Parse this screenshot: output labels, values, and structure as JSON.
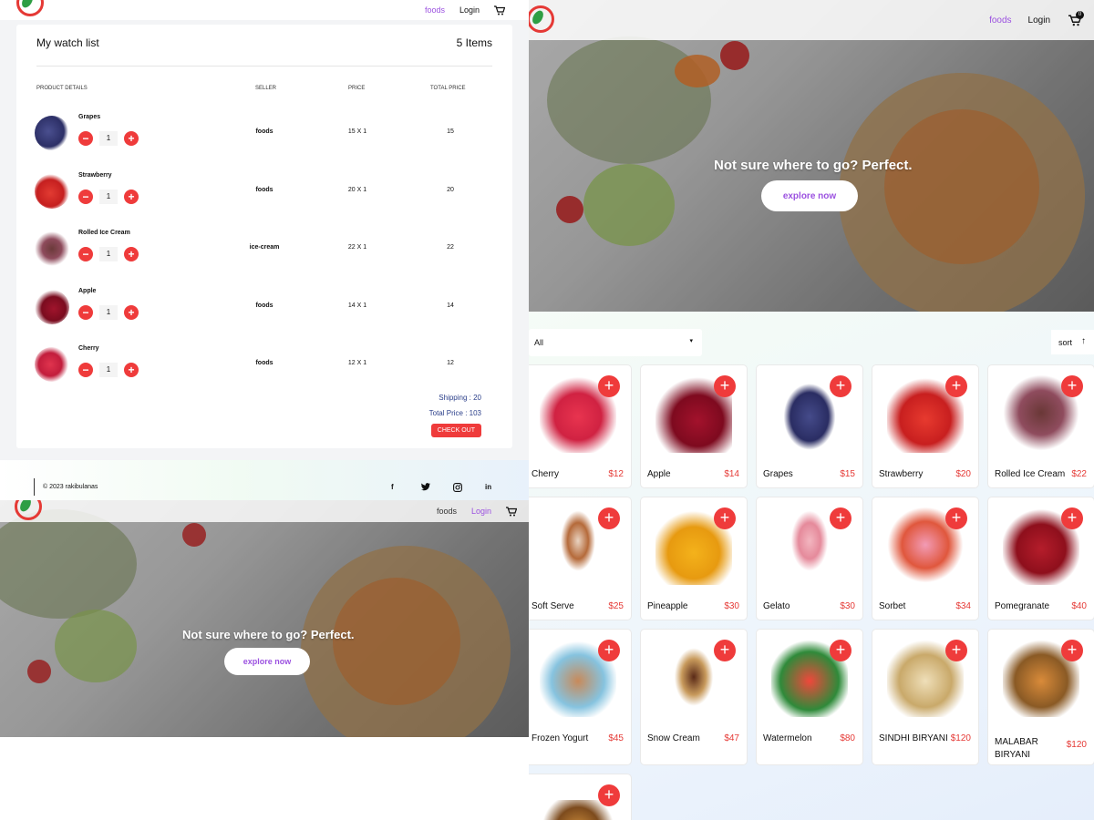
{
  "nav": {
    "foods": "foods",
    "login": "Login",
    "cart_count": "0"
  },
  "watchlist": {
    "title": "My watch list",
    "count": "5 Items",
    "headers": [
      "PRODUCT DETAILS",
      "SELLER",
      "PRICE",
      "TOTAL PRICE"
    ],
    "items": [
      {
        "name": "Grapes",
        "qty": "1",
        "seller": "foods",
        "price": "15 X 1",
        "total": "15"
      },
      {
        "name": "Strawberry",
        "qty": "1",
        "seller": "foods",
        "price": "20 X 1",
        "total": "20"
      },
      {
        "name": "Rolled Ice Cream",
        "qty": "1",
        "seller": "ice-cream",
        "price": "22 X 1",
        "total": "22"
      },
      {
        "name": "Apple",
        "qty": "1",
        "seller": "foods",
        "price": "14 X 1",
        "total": "14"
      },
      {
        "name": "Cherry",
        "qty": "1",
        "seller": "foods",
        "price": "12 X 1",
        "total": "12"
      }
    ],
    "shipping": "Shipping : 20",
    "total_price": "Total Price : 103",
    "checkout": "CHECK OUT"
  },
  "footer": {
    "copyright": "© 2023 rakibulanas",
    "social": [
      "f",
      "t",
      "ig",
      "in"
    ]
  },
  "hero": {
    "title": "Not sure where to go? Perfect.",
    "button": "explore now"
  },
  "filter": {
    "selected": "All",
    "sort_label": "sort"
  },
  "products": [
    {
      "name": "Cherry",
      "price": "$12"
    },
    {
      "name": "Apple",
      "price": "$14"
    },
    {
      "name": "Grapes",
      "price": "$15"
    },
    {
      "name": "Strawberry",
      "price": "$20"
    },
    {
      "name": "Rolled Ice Cream",
      "price": "$22"
    },
    {
      "name": "Soft Serve",
      "price": "$25"
    },
    {
      "name": "Pineapple",
      "price": "$30"
    },
    {
      "name": "Gelato",
      "price": "$30"
    },
    {
      "name": "Sorbet",
      "price": "$34"
    },
    {
      "name": "Pomegranate",
      "price": "$40"
    },
    {
      "name": "Frozen Yogurt",
      "price": "$45"
    },
    {
      "name": "Snow Cream",
      "price": "$47"
    },
    {
      "name": "Watermelon",
      "price": "$80"
    },
    {
      "name": "SINDHI BIRYANI",
      "price": "$120"
    },
    {
      "name": "MALABAR BIRYANI",
      "price": "$120"
    }
  ],
  "colors": {
    "accent": "#9b51e0",
    "danger": "#ef3b3b",
    "link_blue": "#2b3f8a"
  },
  "icons": {
    "cart": "cart-icon",
    "plus": "plus-icon",
    "minus": "minus-icon",
    "chevron": "chevron-down-icon",
    "sort": "arrow-up-icon",
    "facebook": "facebook-icon",
    "twitter": "twitter-icon",
    "instagram": "instagram-icon",
    "linkedin": "linkedin-icon"
  }
}
